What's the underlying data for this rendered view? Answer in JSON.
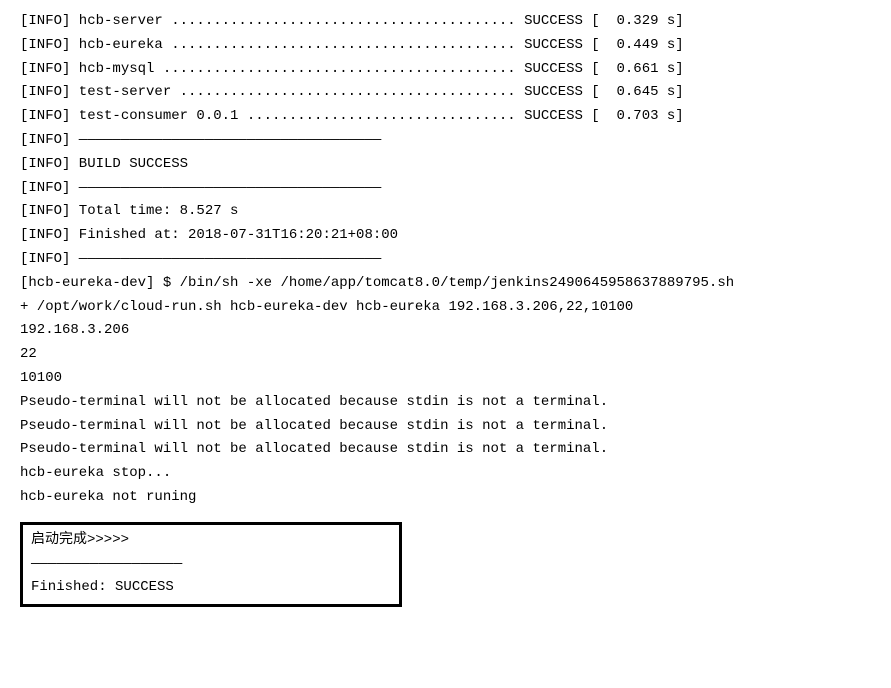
{
  "lines": [
    "[INFO] hcb-server ......................................... SUCCESS [  0.329 s]",
    "[INFO] hcb-eureka ......................................... SUCCESS [  0.449 s]",
    "[INFO] hcb-mysql .......................................... SUCCESS [  0.661 s]",
    "[INFO] test-server ........................................ SUCCESS [  0.645 s]",
    "[INFO] test-consumer 0.0.1 ................................ SUCCESS [  0.703 s]",
    "[INFO] ————————————————————————————————————",
    "[INFO] BUILD SUCCESS",
    "[INFO] ————————————————————————————————————",
    "[INFO] Total time: 8.527 s",
    "[INFO] Finished at: 2018-07-31T16:20:21+08:00",
    "[INFO] ————————————————————————————————————",
    "[hcb-eureka-dev] $ /bin/sh -xe /home/app/tomcat8.0/temp/jenkins2490645958637889795.sh",
    "+ /opt/work/cloud-run.sh hcb-eureka-dev hcb-eureka 192.168.3.206,22,10100",
    "192.168.3.206",
    "22",
    "10100",
    "Pseudo-terminal will not be allocated because stdin is not a terminal.",
    "Pseudo-terminal will not be allocated because stdin is not a terminal.",
    "Pseudo-terminal will not be allocated because stdin is not a terminal.",
    "hcb-eureka stop...",
    "hcb-eureka not runing"
  ],
  "finalBox": {
    "line1": "启动完成>>>>>",
    "line2": "——————————————————",
    "line3": "Finished: SUCCESS"
  }
}
